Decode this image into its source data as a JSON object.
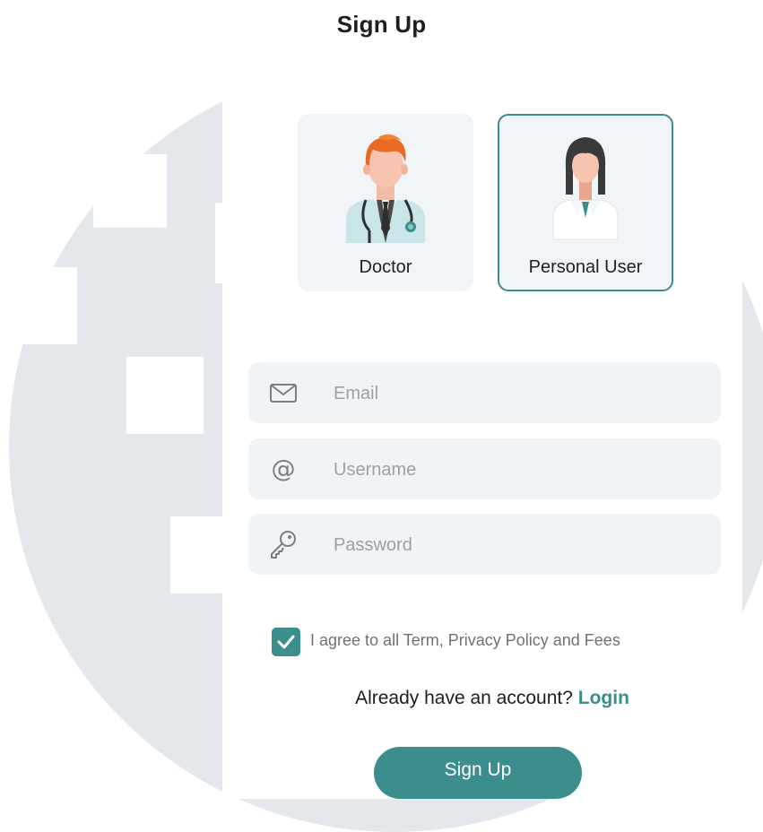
{
  "header": {
    "title": "Sign Up"
  },
  "roles": [
    {
      "label": "Doctor",
      "selected": false,
      "icon": "doctor-avatar-icon"
    },
    {
      "label": "Personal User",
      "selected": true,
      "icon": "personal-user-avatar-icon"
    }
  ],
  "form": {
    "email": {
      "placeholder": "Email",
      "value": "",
      "icon": "envelope-icon"
    },
    "username": {
      "placeholder": "Username",
      "value": "",
      "icon": "at-sign-icon"
    },
    "password": {
      "placeholder": "Password",
      "value": "",
      "icon": "key-icon"
    }
  },
  "terms": {
    "checked": true,
    "label": "I agree to all Term, Privacy Policy and Fees"
  },
  "login": {
    "prompt": "Already have an account?",
    "link_label": "Login"
  },
  "actions": {
    "signup_label": "Sign Up"
  },
  "colors": {
    "accent": "#3b8e8c",
    "field_bg": "#f1f4f6",
    "background_circle": "#e4e8ed",
    "text_dark": "#1d1d22",
    "placeholder": "#9ca1a6"
  }
}
